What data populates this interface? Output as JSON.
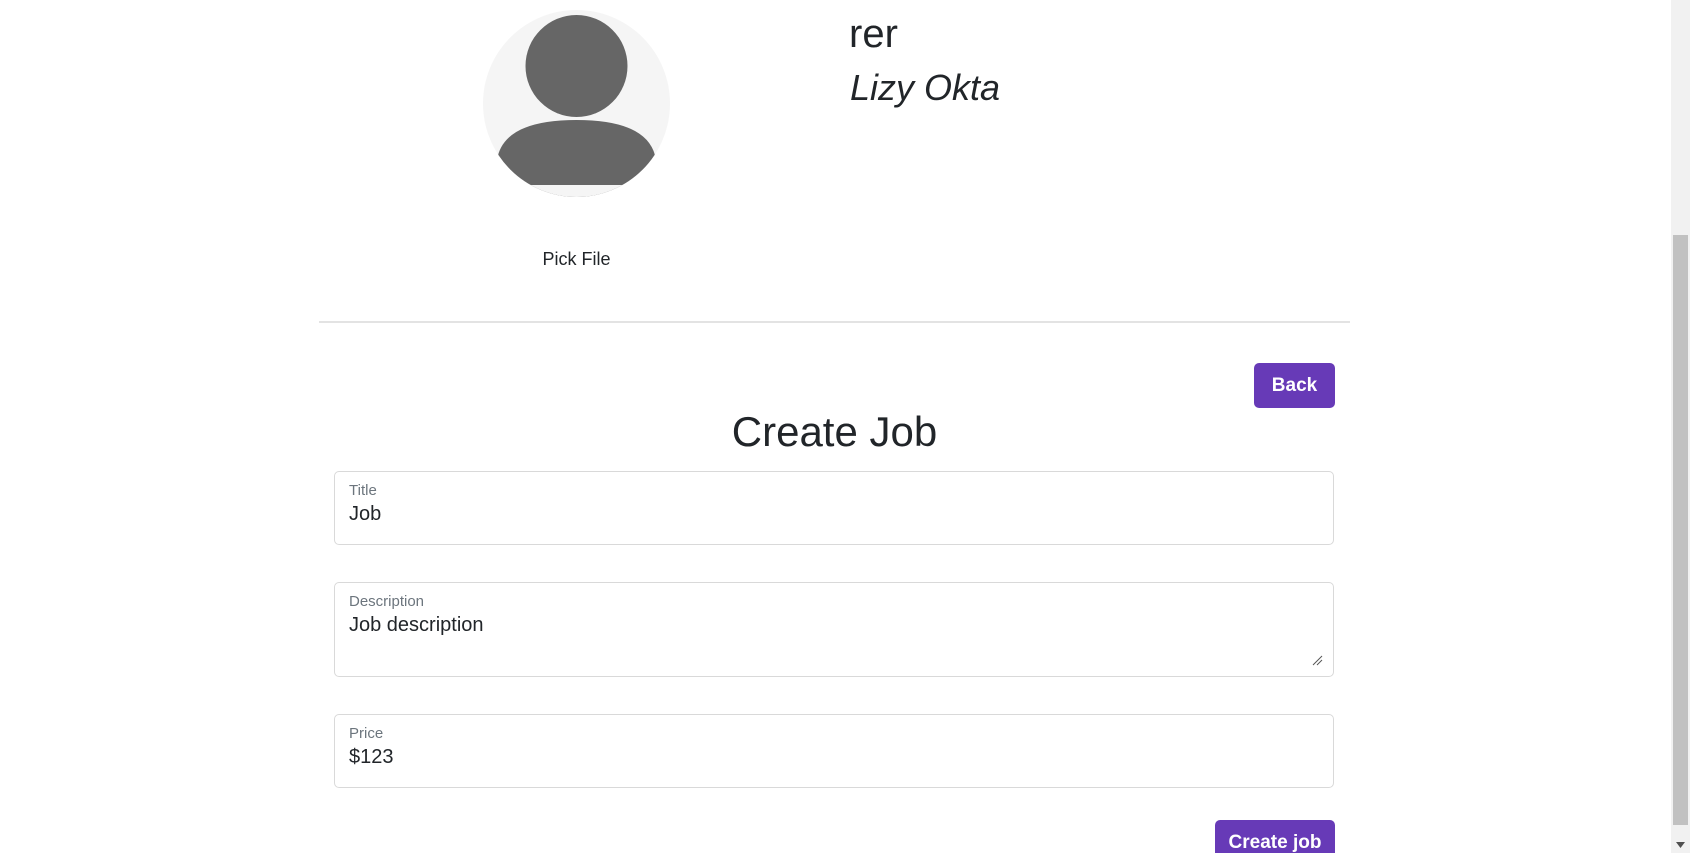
{
  "profile": {
    "username": "rer",
    "full_name": "Lizy Okta",
    "avatar_icon": "user-avatar-icon",
    "pick_file_label": "Pick File"
  },
  "form": {
    "back_label": "Back",
    "title": "Create Job",
    "fields": {
      "title": {
        "label": "Title",
        "value": "Job"
      },
      "description": {
        "label": "Description",
        "value": "Job description"
      },
      "price": {
        "label": "Price",
        "value": "$123"
      }
    },
    "submit_label": "Create job"
  },
  "colors": {
    "accent": "#673ab7",
    "text": "#212529",
    "muted": "#6c757d",
    "avatar_bg": "#f5f5f5",
    "avatar_fg": "#666666"
  }
}
